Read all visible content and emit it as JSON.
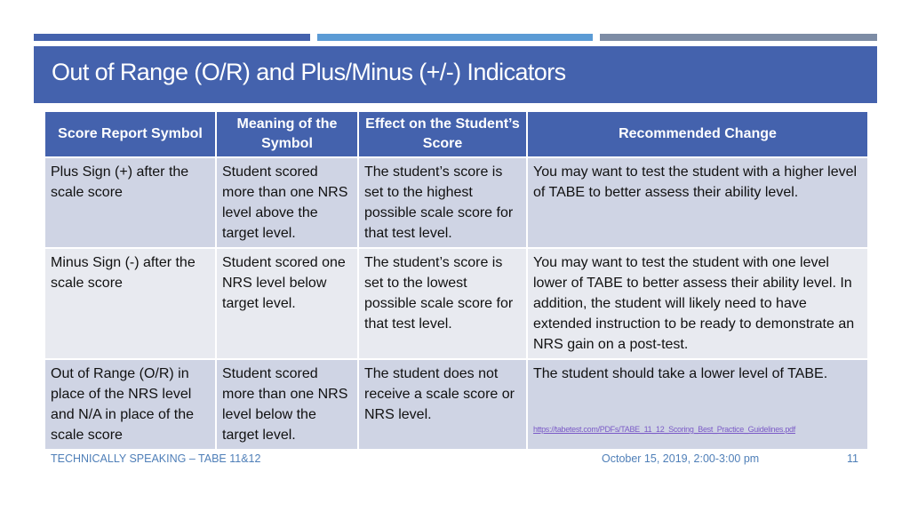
{
  "slide": {
    "title": "Out of Range (O/R) and Plus/Minus (+/-) Indicators",
    "accent_colors": [
      "#4462ad",
      "#5b9bd5",
      "#7d8ca5"
    ]
  },
  "table": {
    "headers": [
      "Score Report Symbol",
      "Meaning of the Symbol",
      "Effect on the Student’s Score",
      "Recommended Change"
    ],
    "rows": [
      {
        "symbol": "Plus Sign (+) after the scale score",
        "meaning": "Student scored more than one NRS level above the target level.",
        "effect": "The student’s score is set to the highest possible scale score for that test level.",
        "recommendation": "You may want to test the student with a higher level of TABE to better assess their ability level."
      },
      {
        "symbol": "Minus Sign (-) after the scale score",
        "meaning": "Student scored one NRS level below target level.",
        "effect": "The student’s score is set to the lowest possible scale score for that test level.",
        "recommendation": "You may want to test the student with one level lower of TABE to better assess their ability level. In addition, the student will likely need to have extended instruction to be ready to demonstrate an NRS gain on a post-test."
      },
      {
        "symbol": "Out of Range (O/R) in place of the NRS level and N/A in place of the scale score",
        "meaning": "Student scored more than one NRS level below the target level.",
        "effect": "The student does not receive a scale score or NRS level.",
        "recommendation": "The student should take a lower level of TABE.",
        "link": "https://tabetest.com/PDFs/TABE_11_12_Scoring_Best_Practice_Guidelines.pdf"
      }
    ]
  },
  "footer": {
    "left": "TECHNICALLY SPEAKING – TABE 11&12",
    "date": "October 15, 2019, 2:00-3:00 pm",
    "page": "11"
  }
}
